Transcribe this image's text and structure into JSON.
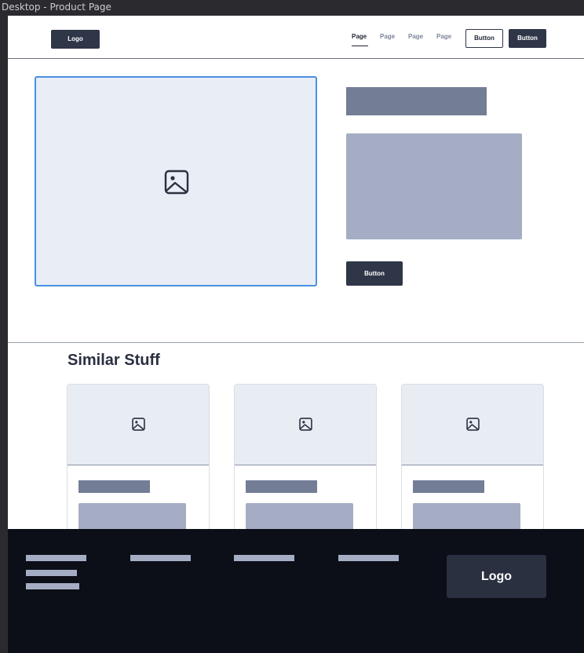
{
  "frame": {
    "title": "Desktop - Product Page"
  },
  "header": {
    "logo_label": "Logo",
    "nav": [
      {
        "label": "Page",
        "active": true
      },
      {
        "label": "Page",
        "active": false
      },
      {
        "label": "Page",
        "active": false
      },
      {
        "label": "Page",
        "active": false
      }
    ],
    "button_outline_label": "Button",
    "button_solid_label": "Button"
  },
  "product": {
    "image_icon": "image-icon",
    "button_label": "Button"
  },
  "similar": {
    "heading": "Similar Stuff",
    "cards": [
      {
        "image_icon": "image-icon"
      },
      {
        "image_icon": "image-icon"
      },
      {
        "image_icon": "image-icon"
      }
    ]
  },
  "footer": {
    "logo_label": "Logo"
  },
  "colors": {
    "primary": "#2f3648",
    "selection": "#4a90e2",
    "placeholder_dark": "#737d96",
    "placeholder_light": "#a4adc3",
    "footer_bg": "#0c0e18"
  }
}
